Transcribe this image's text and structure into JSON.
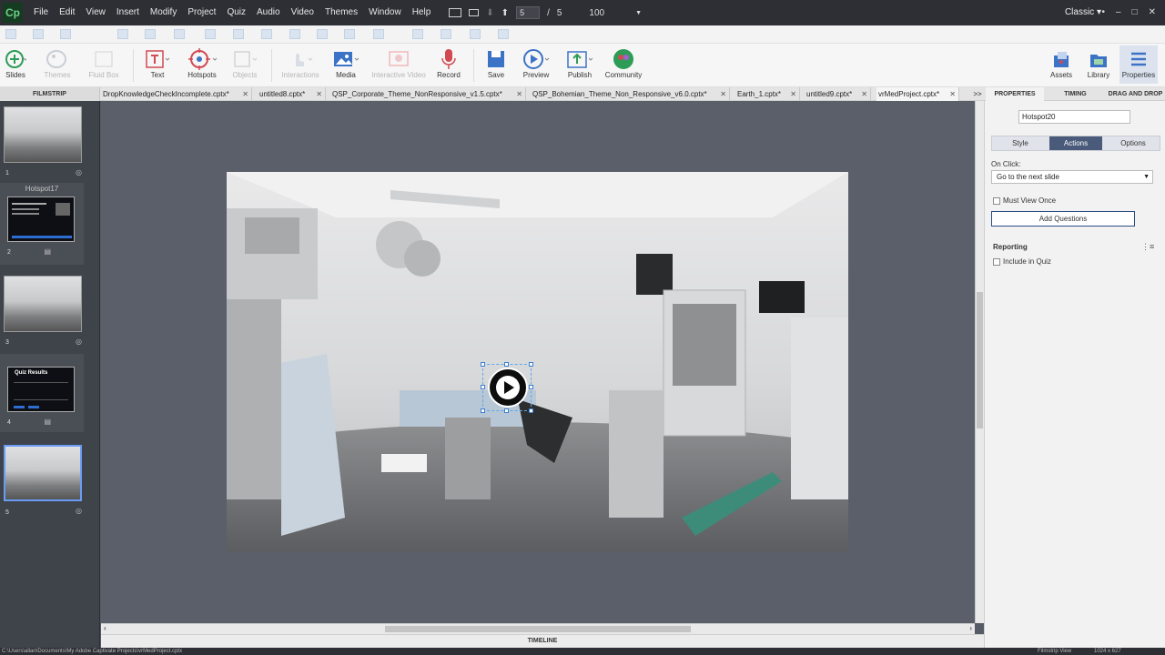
{
  "app": {
    "logo": "Cp",
    "menu": [
      "File",
      "Edit",
      "View",
      "Insert",
      "Modify",
      "Project",
      "Quiz",
      "Audio",
      "Video",
      "Themes",
      "Window",
      "Help"
    ],
    "page_current": "5",
    "page_sep": "/",
    "page_total": "5",
    "zoom": "100",
    "workspace": "Classic",
    "window_controls": [
      "•",
      "–",
      "□",
      "✕"
    ]
  },
  "toolbar": {
    "slides": "Slides",
    "themes": "Themes",
    "fluid_box": "Fluid Box",
    "text": "Text",
    "hotspots": "Hotspots",
    "objects": "Objects",
    "interactions": "Interactions",
    "media": "Media",
    "interactive_video": "Interactive Video",
    "record": "Record",
    "save": "Save",
    "preview": "Preview",
    "publish": "Publish",
    "community": "Community",
    "assets": "Assets",
    "library": "Library",
    "properties": "Properties"
  },
  "filmstrip": {
    "label": "FILMSTRIP",
    "group_label": "Hotspot17",
    "slides": [
      {
        "num": "1",
        "kind": "photo"
      },
      {
        "num": "2",
        "kind": "dark",
        "title": ""
      },
      {
        "num": "3",
        "kind": "photo"
      },
      {
        "num": "4",
        "kind": "dark",
        "title": "Quiz Results"
      },
      {
        "num": "5",
        "kind": "photo"
      }
    ]
  },
  "tabs": [
    {
      "label": "DropKnowledgeCheckIncomplete.cptx*"
    },
    {
      "label": "untitled8.cptx*"
    },
    {
      "label": "QSP_Corporate_Theme_NonResponsive_v1.5.cptx*"
    },
    {
      "label": "QSP_Bohemian_Theme_Non_Responsive_v6.0.cptx*"
    },
    {
      "label": "Earth_1.cptx*"
    },
    {
      "label": "untitled9.cptx*"
    },
    {
      "label": "vrMedProject.cptx*"
    }
  ],
  "tabs_more": ">>",
  "panel_tabs": [
    "PROPERTIES",
    "TIMING",
    "DRAG AND DROP"
  ],
  "properties": {
    "object_name": "Hotspot20",
    "subtabs": [
      "Style",
      "Actions",
      "Options"
    ],
    "active_subtab": "Actions",
    "on_click_label": "On Click:",
    "on_click_value": "Go to the next slide",
    "must_view_once": "Must View Once",
    "add_questions": "Add Questions",
    "reporting": "Reporting",
    "include_in_quiz": "Include in Quiz"
  },
  "timeline_label": "TIMELINE",
  "status": {
    "path": "C:\\Users\\allan\\Documents\\My Adobe Captivate Projects\\vrMedProject.cptx",
    "view": "Filmstrip View",
    "size": "1024 x 627"
  },
  "colors": {
    "menubar": "#2d2f35",
    "filmstrip": "#3f434a",
    "canvas": "#5a5f69",
    "accent": "#4a5a7a",
    "selection": "#6b9cf5"
  }
}
